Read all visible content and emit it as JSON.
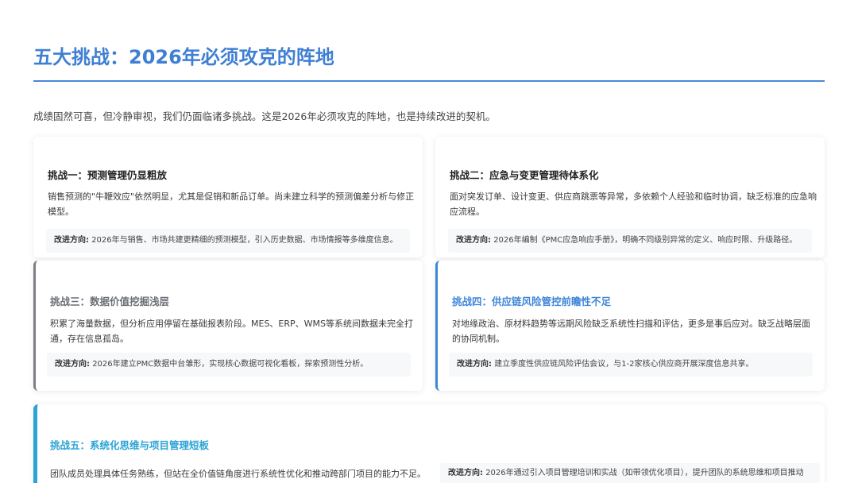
{
  "page": {
    "title": "五大挑战：2026年必须攻克的阵地",
    "intro": "成绩固然可喜，但冷静审视，我们仍面临诸多挑战。这是2026年必须攻克的阵地，也是持续改进的契机。"
  },
  "improve_label": "改进方向:",
  "challenges": [
    {
      "title": "挑战一：预测管理仍显粗放",
      "desc": "销售预测的\"牛鞭效应\"依然明显，尤其是促销和新品订单。尚未建立科学的预测偏差分析与修正模型。",
      "improve": "2026年与销售、市场共建更精细的预测模型，引入历史数据、市场情报等多维度信息。"
    },
    {
      "title": "挑战二：应急与变更管理待体系化",
      "desc": "面对突发订单、设计变更、供应商跳票等异常，多依赖个人经验和临时协调，缺乏标准的应急响应流程。",
      "improve": "2026年编制《PMC应急响应手册》，明确不同级别异常的定义、响应时限、升级路径。"
    },
    {
      "title": "挑战三：数据价值挖掘浅层",
      "desc": "积累了海量数据，但分析应用停留在基础报表阶段。MES、ERP、WMS等系统间数据未完全打通，存在信息孤岛。",
      "improve": "2026年建立PMC数据中台雏形，实现核心数据可视化看板，探索预测性分析。"
    },
    {
      "title": "挑战四：供应链风险管控前瞻性不足",
      "desc": "对地缘政治、原材料趋势等远期风险缺乏系统性扫描和评估，更多是事后应对。缺乏战略层面的协同机制。",
      "improve": "建立季度性供应链风险评估会议，与1-2家核心供应商开展深度信息共享。"
    },
    {
      "title": "挑战五：系统化思维与项目管理短板",
      "desc": "团队成员处理具体任务熟练，但站在全价值链角度进行系统性优化和推动跨部门项目的能力不足。",
      "improve": "2026年通过引入项目管理培训和实战（如带领优化项目），提升团队的系统思维和项目推动"
    }
  ]
}
